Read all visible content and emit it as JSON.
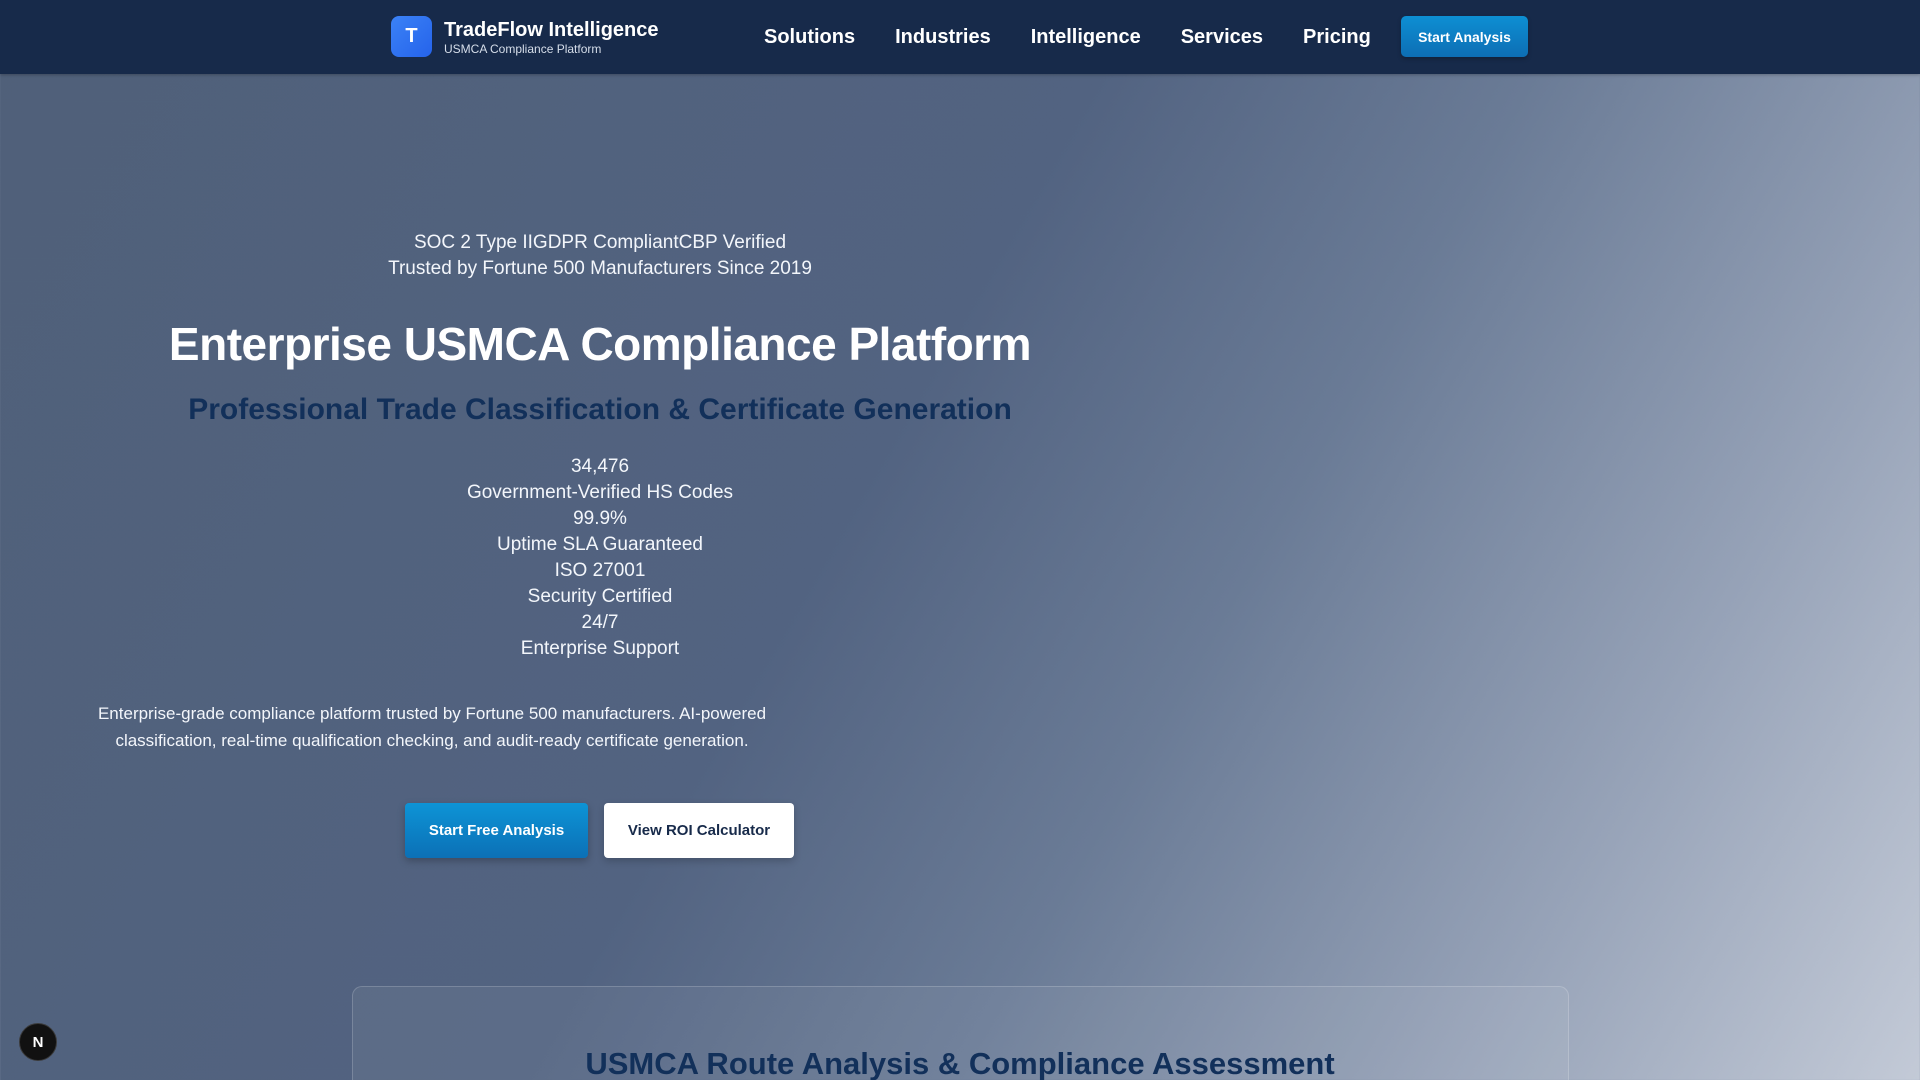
{
  "header": {
    "logo_letter": "T",
    "brand_name": "TradeFlow Intelligence",
    "tagline": "USMCA Compliance Platform",
    "nav": [
      {
        "label": "Solutions"
      },
      {
        "label": "Industries"
      },
      {
        "label": "Intelligence"
      },
      {
        "label": "Services"
      },
      {
        "label": "Pricing"
      }
    ],
    "cta_label": "Start Analysis"
  },
  "hero": {
    "trust_badges": "SOC 2 Type IIGDPR CompliantCBP Verified",
    "trust_line": "Trusted by Fortune 500 Manufacturers Since 2019",
    "title": "Enterprise USMCA Compliance Platform",
    "subtitle": "Professional Trade Classification & Certificate Generation",
    "stats": [
      {
        "value": "34,476",
        "label": "Government-Verified HS Codes"
      },
      {
        "value": "99.9%",
        "label": "Uptime SLA Guaranteed"
      },
      {
        "value": "ISO 27001",
        "label": "Security Certified"
      },
      {
        "value": "24/7",
        "label": "Enterprise Support"
      }
    ],
    "description": "Enterprise-grade compliance platform trusted by Fortune 500 manufacturers. AI-powered classification, real-time qualification checking, and audit-ready certificate generation.",
    "primary_button": "Start Free Analysis",
    "secondary_button": "View ROI Calculator"
  },
  "route_section": {
    "title": "USMCA Route Analysis & Compliance Assessment"
  },
  "floating_badge": {
    "letter": "N"
  },
  "colors": {
    "header_bg": "#172a4a",
    "accent_blue": "#0d8fd3",
    "subtitle_navy": "#12305a",
    "logo_blue": "#2563eb"
  }
}
